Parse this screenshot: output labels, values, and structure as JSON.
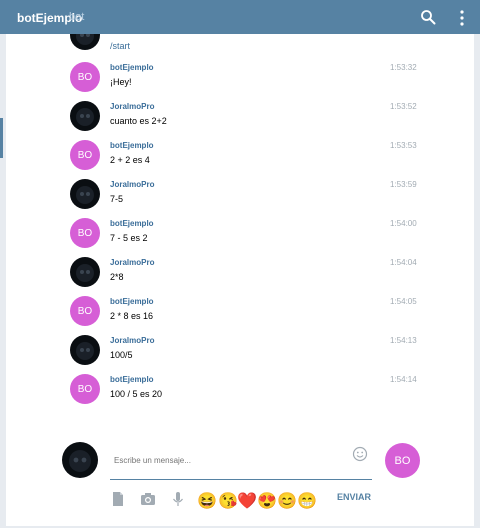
{
  "header": {
    "title": "botEjemplo",
    "subtitle": "bot",
    "search_icon": "search-icon",
    "menu_icon": "more-vertical-icon",
    "color": "#5682a3"
  },
  "start_command": "/start",
  "messages": [
    {
      "author": "botEjemplo",
      "time": "1:53:32",
      "text": "¡Hey!",
      "kind": "bot"
    },
    {
      "author": "JoralmoPro",
      "time": "1:53:52",
      "text": "cuanto es 2+2",
      "kind": "user"
    },
    {
      "author": "botEjemplo",
      "time": "1:53:53",
      "text": "2 + 2 es 4",
      "kind": "bot"
    },
    {
      "author": "JoralmoPro",
      "time": "1:53:59",
      "text": "7-5",
      "kind": "user"
    },
    {
      "author": "botEjemplo",
      "time": "1:54:00",
      "text": "7 - 5 es 2",
      "kind": "bot"
    },
    {
      "author": "JoralmoPro",
      "time": "1:54:04",
      "text": "2*8",
      "kind": "user"
    },
    {
      "author": "botEjemplo",
      "time": "1:54:05",
      "text": "2 * 8 es 16",
      "kind": "bot"
    },
    {
      "author": "JoralmoPro",
      "time": "1:54:13",
      "text": "100/5",
      "kind": "user"
    },
    {
      "author": "botEjemplo",
      "time": "1:54:14",
      "text": "100 / 5 es 20",
      "kind": "bot"
    }
  ],
  "bot_initials": "BO",
  "compose": {
    "placeholder": "Escribe un mensaje...",
    "send_label": "ENVIAR",
    "emojis": [
      "😆",
      "😘",
      "❤️",
      "😍",
      "😊",
      "😁"
    ],
    "tools": [
      "document-icon",
      "camera-icon",
      "microphone-icon"
    ]
  },
  "colors": {
    "bot_avatar": "#d65ed6",
    "link": "#3a6d99"
  }
}
